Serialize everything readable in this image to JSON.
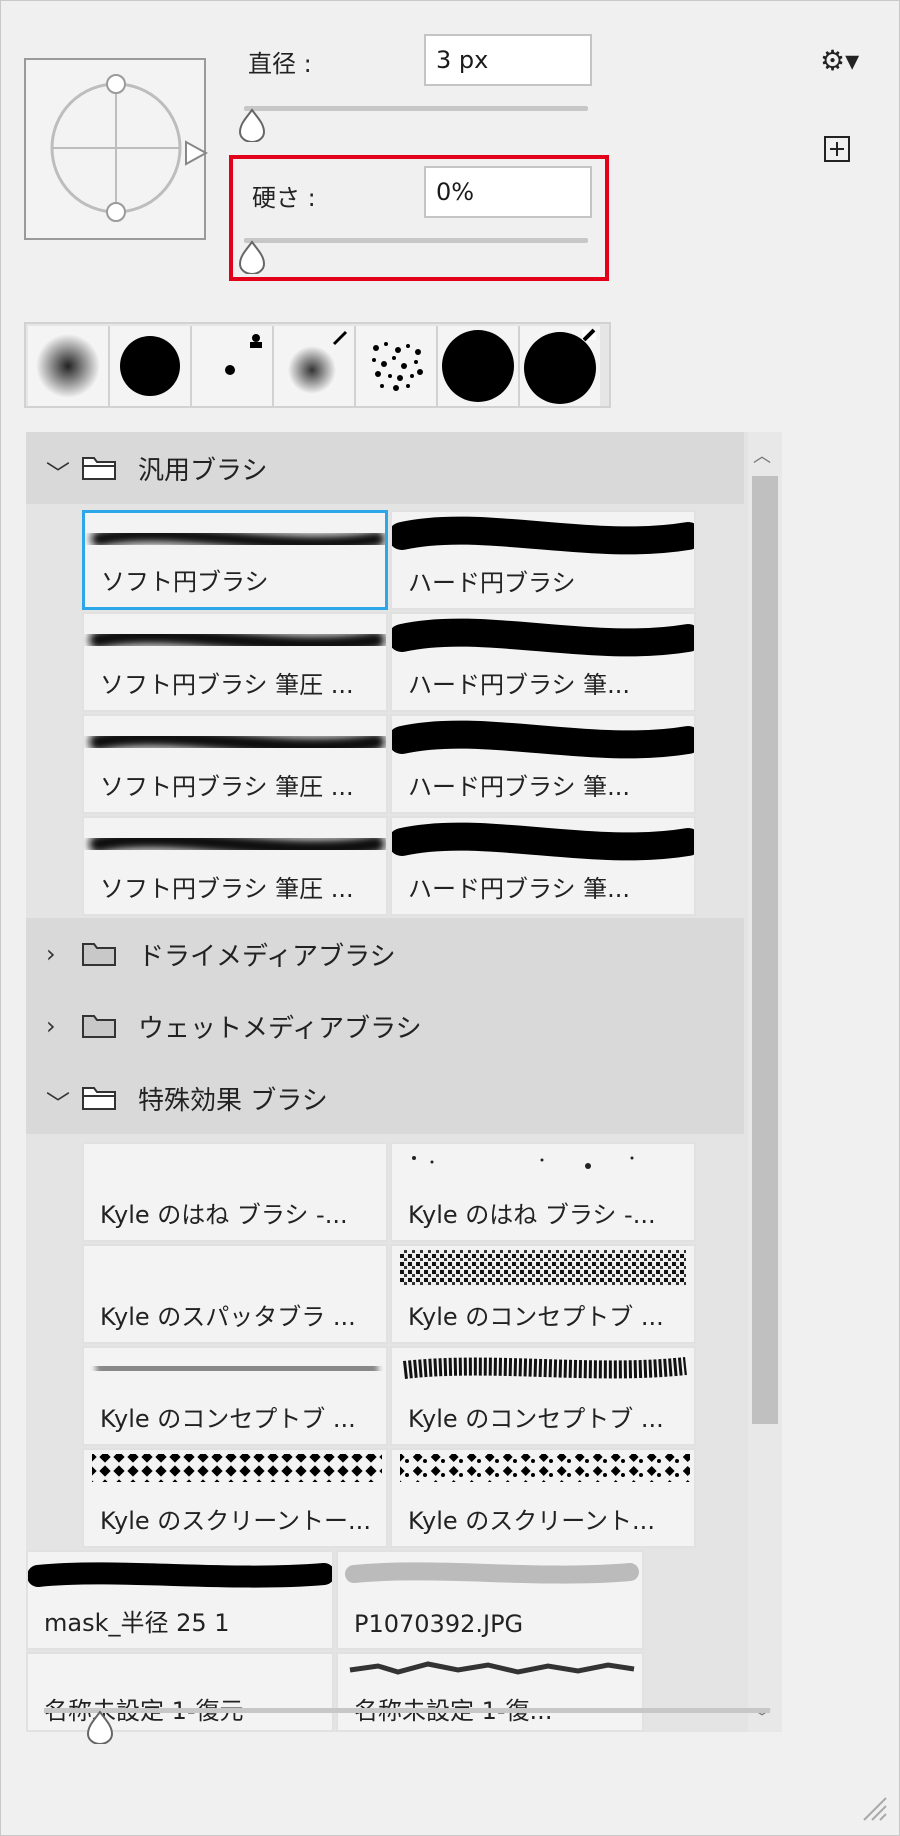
{
  "brush_settings": {
    "diameter_label": "直径 :",
    "diameter_value": "3 px",
    "hardness_label": "硬さ :",
    "hardness_value": "0%"
  },
  "toolbar": {
    "settings_icon": "gear-icon",
    "new_preset_icon": "plus-square-icon"
  },
  "recent_tips_icons": [
    "soft-round-tip",
    "hard-round-tip",
    "small-dot-tip",
    "soft-round-pressure-tip",
    "spatter-tip",
    "hard-round-large-tip",
    "hard-round-eraser-tip"
  ],
  "groups": [
    {
      "name": "汎用ブラシ",
      "expanded": true
    },
    {
      "name": "ドライメディアブラシ",
      "expanded": false
    },
    {
      "name": "ウェットメディアブラシ",
      "expanded": false
    },
    {
      "name": "特殊効果 ブラシ",
      "expanded": true
    }
  ],
  "general_brushes": [
    "ソフト円ブラシ",
    "ハード円ブラシ",
    "ソフト円ブラシ 筆圧 ...",
    "ハード円ブラシ 筆...",
    "ソフト円ブラシ 筆圧 ...",
    "ハード円ブラシ 筆...",
    "ソフト円ブラシ 筆圧 ...",
    "ハード円ブラシ 筆..."
  ],
  "special_brushes": [
    "Kyle のはね ブラシ -...",
    "Kyle のはね ブラシ -...",
    "Kyle のスパッタブラ ...",
    "Kyle のコンセプトブ ...",
    "Kyle のコンセプトブ ...",
    "Kyle のコンセプトブ ...",
    "Kyle のスクリーントー...",
    "Kyle のスクリーント..."
  ],
  "loose_brushes": [
    "mask_半径 25 1",
    "P1070392.JPG",
    "名称未設定 1-復元",
    "名称未設定 1-復..."
  ]
}
